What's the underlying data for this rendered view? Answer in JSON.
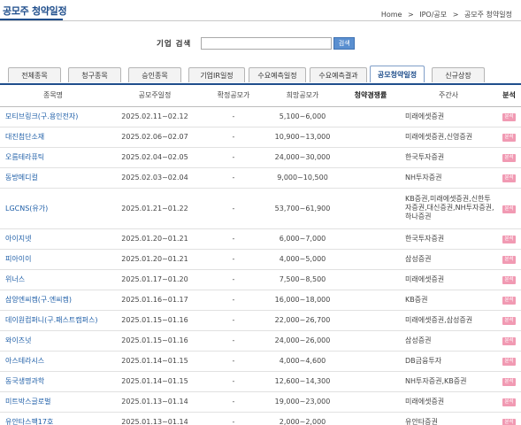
{
  "header": {
    "title": "공모주 청약일정",
    "breadcrumb": [
      "Home",
      "IPO/공모",
      "공모주 청약일정"
    ]
  },
  "search": {
    "label": "기업 검색",
    "input_value": "",
    "button_label": "검색"
  },
  "tabs": [
    {
      "label": "전체종목",
      "active": false
    },
    {
      "label": "청구종목",
      "active": false
    },
    {
      "label": "승인종목",
      "active": false
    },
    {
      "label": "기업IR일정",
      "active": false
    },
    {
      "label": "수요예측일정",
      "active": false
    },
    {
      "label": "수요예측결과",
      "active": false
    },
    {
      "label": "공모청약일정",
      "active": true
    },
    {
      "label": "신규상장",
      "active": false
    }
  ],
  "table": {
    "columns": [
      "종목명",
      "공모주일정",
      "확정공모가",
      "희망공모가",
      "청약경쟁률",
      "주간사",
      "분석"
    ],
    "rows": [
      {
        "name": "모티브링크(구.용인전자)",
        "schedule": "2025.02.11~02.12",
        "confirmed_price": "-",
        "desired_price": "5,100~6,000",
        "competition": "",
        "underwriter": "미래에셋증권",
        "analysis": "분석"
      },
      {
        "name": "대진첨단소재",
        "schedule": "2025.02.06~02.07",
        "confirmed_price": "-",
        "desired_price": "10,900~13,000",
        "competition": "",
        "underwriter": "미래에셋증권,신영증권",
        "analysis": "분석"
      },
      {
        "name": "오름테라퓨틱",
        "schedule": "2025.02.04~02.05",
        "confirmed_price": "-",
        "desired_price": "24,000~30,000",
        "competition": "",
        "underwriter": "한국투자증권",
        "analysis": "분석"
      },
      {
        "name": "동방메디컬",
        "schedule": "2025.02.03~02.04",
        "confirmed_price": "-",
        "desired_price": "9,000~10,500",
        "competition": "",
        "underwriter": "NH투자증권",
        "analysis": "분석"
      },
      {
        "name": "LGCNS(유가)",
        "schedule": "2025.01.21~01.22",
        "confirmed_price": "-",
        "desired_price": "53,700~61,900",
        "competition": "",
        "underwriter": "KB증권,미래에셋증권,신한투자증권,대신증권,NH투자증권,하나증권",
        "analysis": "분석"
      },
      {
        "name": "아이지넷",
        "schedule": "2025.01.20~01.21",
        "confirmed_price": "-",
        "desired_price": "6,000~7,000",
        "competition": "",
        "underwriter": "한국투자증권",
        "analysis": "분석"
      },
      {
        "name": "피아이이",
        "schedule": "2025.01.20~01.21",
        "confirmed_price": "-",
        "desired_price": "4,000~5,000",
        "competition": "",
        "underwriter": "삼성증권",
        "analysis": "분석"
      },
      {
        "name": "위너스",
        "schedule": "2025.01.17~01.20",
        "confirmed_price": "-",
        "desired_price": "7,500~8,500",
        "competition": "",
        "underwriter": "미래에셋증권",
        "analysis": "분석"
      },
      {
        "name": "삼양엔씨켐(구.엔씨켐)",
        "schedule": "2025.01.16~01.17",
        "confirmed_price": "-",
        "desired_price": "16,000~18,000",
        "competition": "",
        "underwriter": "KB증권",
        "analysis": "분석"
      },
      {
        "name": "데이원컴퍼니(구.패스트캠퍼스)",
        "schedule": "2025.01.15~01.16",
        "confirmed_price": "-",
        "desired_price": "22,000~26,700",
        "competition": "",
        "underwriter": "미래에셋증권,삼성증권",
        "analysis": "분석"
      },
      {
        "name": "와이즈넛",
        "schedule": "2025.01.15~01.16",
        "confirmed_price": "-",
        "desired_price": "24,000~26,000",
        "competition": "",
        "underwriter": "삼성증권",
        "analysis": "분석"
      },
      {
        "name": "아스테라시스",
        "schedule": "2025.01.14~01.15",
        "confirmed_price": "-",
        "desired_price": "4,000~4,600",
        "competition": "",
        "underwriter": "DB금융투자",
        "analysis": "분석"
      },
      {
        "name": "동국생명과학",
        "schedule": "2025.01.14~01.15",
        "confirmed_price": "-",
        "desired_price": "12,600~14,300",
        "competition": "",
        "underwriter": "NH투자증권,KB증권",
        "analysis": "분석"
      },
      {
        "name": "미트박스글로벌",
        "schedule": "2025.01.13~01.14",
        "confirmed_price": "-",
        "desired_price": "19,000~23,000",
        "competition": "",
        "underwriter": "미래에셋증권",
        "analysis": "분석"
      },
      {
        "name": "유안타스팩17호",
        "schedule": "2025.01.13~01.14",
        "confirmed_price": "-",
        "desired_price": "2,000~2,000",
        "competition": "",
        "underwriter": "유안타증권",
        "analysis": "분석"
      }
    ]
  }
}
